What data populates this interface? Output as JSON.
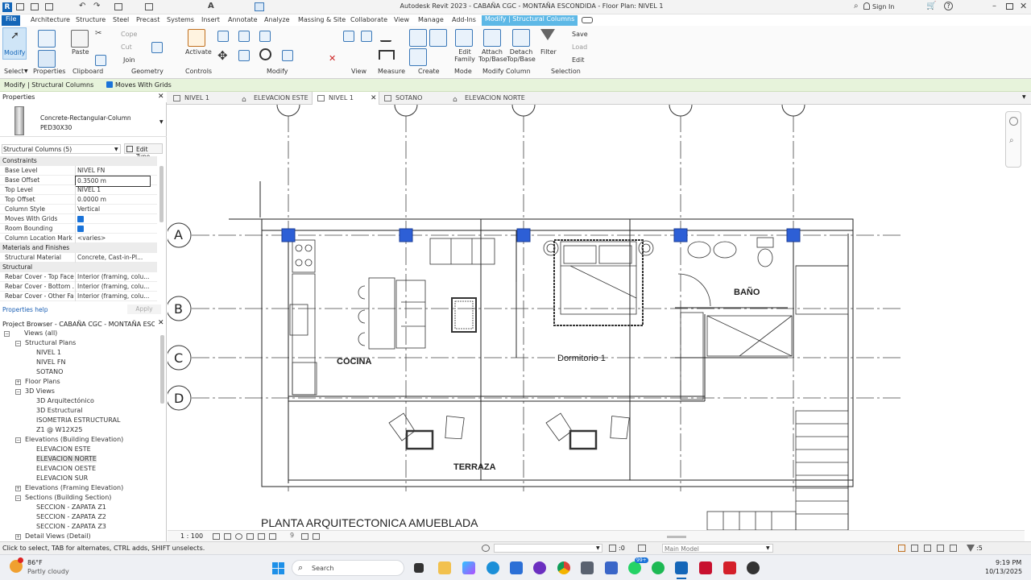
{
  "title": "Autodesk Revit 2023 - CABAÑA CGC - MONTAÑA ESCONDIDA - Floor Plan: NIVEL 1",
  "signin": "Sign In",
  "menu_tabs": [
    "File",
    "Architecture",
    "Structure",
    "Steel",
    "Precast",
    "Systems",
    "Insert",
    "Annotate",
    "Analyze",
    "Massing & Site",
    "Collaborate",
    "View",
    "Manage",
    "Add-Ins",
    "Modify | Structural Columns"
  ],
  "ribbon": {
    "modify": "Modify",
    "paste": "Paste",
    "cope": "Cope",
    "cut": "Cut",
    "join": "Join",
    "activate": "Activate",
    "save": "Save",
    "load": "Load",
    "edit": "Edit",
    "edit_family": "Edit Family",
    "attach": "Attach Top/Base",
    "detach": "Detach Top/Base",
    "filter": "Filter",
    "groups": [
      "Select",
      "Properties",
      "Clipboard",
      "Geometry",
      "Controls",
      "Modify",
      "View",
      "Measure",
      "Create",
      "Mode",
      "Modify Column",
      "Selection"
    ]
  },
  "options_bar": {
    "context": "Modify | Structural Columns",
    "moves_with_grids": "Moves With Grids"
  },
  "properties": {
    "header": "Properties",
    "family": "Concrete-Rectangular-Column",
    "type": "PED30X30",
    "filter": "Structural Columns (5)",
    "edit_type": "Edit Type",
    "sections": {
      "constraints": "Constraints",
      "materials": "Materials and Finishes",
      "structural": "Structural"
    },
    "rows": [
      {
        "k": "Base Level",
        "v": "NIVEL FN"
      },
      {
        "k": "Base Offset",
        "v": "0.3500 m"
      },
      {
        "k": "Top Level",
        "v": "NIVEL 1"
      },
      {
        "k": "Top Offset",
        "v": "0.0000 m"
      },
      {
        "k": "Column Style",
        "v": "Vertical"
      },
      {
        "k": "Moves With Grids",
        "v": ""
      },
      {
        "k": "Room Bounding",
        "v": ""
      },
      {
        "k": "Column Location Mark",
        "v": "<varies>"
      }
    ],
    "material_rows": [
      {
        "k": "Structural Material",
        "v": "Concrete, Cast-in-Pl..."
      }
    ],
    "structural_rows": [
      {
        "k": "Rebar Cover - Top Face",
        "v": "Interior (framing, colu..."
      },
      {
        "k": "Rebar Cover - Bottom ...",
        "v": "Interior (framing, colu..."
      },
      {
        "k": "Rebar Cover - Other Fa...",
        "v": "Interior (framing, colu..."
      }
    ],
    "help": "Properties help",
    "apply": "Apply"
  },
  "browser": {
    "header": "Project Browser - CABAÑA CGC - MONTAÑA ESCON...",
    "items": [
      "Views (all)",
      "Structural Plans",
      "NIVEL 1",
      "NIVEL FN",
      "SOTANO",
      "Floor Plans",
      "3D Views",
      "3D Arquitectónico",
      "3D Estructural",
      "ISOMETRIA ESTRUCTURAL",
      "Z1 @ W12X25",
      "Elevations (Building Elevation)",
      "ELEVACION ESTE",
      "ELEVACION NORTE",
      "ELEVACION OESTE",
      "ELEVACION SUR",
      "Elevations (Framing Elevation)",
      "Sections (Building Section)",
      "SECCION - ZAPATA Z1",
      "SECCION - ZAPATA Z2",
      "SECCION - ZAPATA Z3",
      "Detail Views (Detail)"
    ]
  },
  "view_tabs": [
    "NIVEL 1",
    "ELEVACION ESTE",
    "NIVEL 1",
    "SOTANO",
    "ELEVACION NORTE"
  ],
  "plan": {
    "grid_rows": [
      "A",
      "B",
      "C",
      "D"
    ],
    "rooms": [
      "COCINA",
      "Dormitorio 1",
      "BAÑO",
      "TERRAZA"
    ],
    "title": "PLANTA ARQUITECTONICA AMUEBLADA"
  },
  "view_control": {
    "scale": "1 : 100"
  },
  "statusbar": {
    "message": "Click to select, TAB for alternates, CTRL adds, SHIFT unselects.",
    "zero": ":0",
    "model": "Main Model",
    "filter_count": ":5"
  },
  "taskbar": {
    "temp": "86°F",
    "weather": "Partly cloudy",
    "search": "Search",
    "badge": "99+",
    "time": "9:19 PM",
    "date": "10/13/2025"
  },
  "colors": {
    "accent": "#1466b8",
    "selection": "#2d5fd6",
    "ribbon_tab": "#5db8e6",
    "options_bar": "#e7f3db"
  }
}
